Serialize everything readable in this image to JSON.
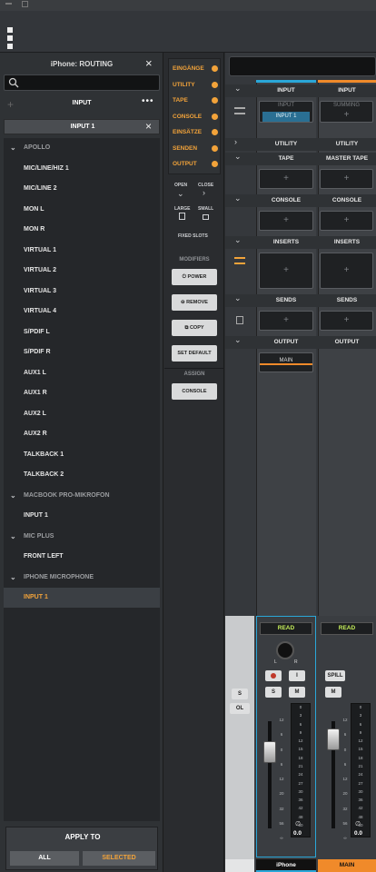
{
  "routing": {
    "title": "iPhone: ROUTING",
    "tab_label": "INPUT",
    "selected_input": "INPUT 1",
    "items": [
      {
        "label": "APOLLO",
        "type": "group"
      },
      {
        "label": "MIC/LINE/HIZ 1",
        "type": "item"
      },
      {
        "label": "MIC/LINE 2",
        "type": "item"
      },
      {
        "label": "MON L",
        "type": "item"
      },
      {
        "label": "MON R",
        "type": "item"
      },
      {
        "label": "VIRTUAL 1",
        "type": "item"
      },
      {
        "label": "VIRTUAL 2",
        "type": "item"
      },
      {
        "label": "VIRTUAL 3",
        "type": "item"
      },
      {
        "label": "VIRTUAL 4",
        "type": "item"
      },
      {
        "label": "S/PDIF L",
        "type": "item"
      },
      {
        "label": "S/PDIF R",
        "type": "item"
      },
      {
        "label": "AUX1 L",
        "type": "item"
      },
      {
        "label": "AUX1 R",
        "type": "item"
      },
      {
        "label": "AUX2 L",
        "type": "item"
      },
      {
        "label": "AUX2 R",
        "type": "item"
      },
      {
        "label": "TALKBACK 1",
        "type": "item"
      },
      {
        "label": "TALKBACK 2",
        "type": "item"
      },
      {
        "label": "MACBOOK PRO-MIKROFON",
        "type": "group"
      },
      {
        "label": "INPUT 1",
        "type": "item"
      },
      {
        "label": "MIC PLUS",
        "type": "group"
      },
      {
        "label": "FRONT LEFT",
        "type": "item"
      },
      {
        "label": "IPHONE MICROPHONE",
        "type": "group"
      },
      {
        "label": "INPUT 1",
        "type": "selected"
      }
    ],
    "apply": {
      "title": "APPLY TO",
      "all": "ALL",
      "selected": "SELECTED"
    }
  },
  "nav": {
    "items": [
      "EINGÄNGE",
      "UTILITY",
      "TAPE",
      "CONSOLE",
      "EINSÄTZE",
      "SENDEN",
      "OUTPUT"
    ],
    "open": "OPEN",
    "close": "CLOSE",
    "large": "LARGE",
    "small": "SMALL",
    "fixed_slots": "FIXED SLOTS"
  },
  "modifiers": {
    "title": "MODIFIERS",
    "power": "POWER",
    "remove": "REMOVE",
    "copy": "COPY",
    "set_default": "SET DEFAULT"
  },
  "assign": {
    "title": "ASSIGN",
    "console": "CONSOLE"
  },
  "strips": {
    "rows": {
      "input": "INPUT",
      "utility": "UTILITY",
      "tape": "TAPE",
      "master_tape": "MASTER TAPE",
      "console": "CONSOLE",
      "inserts": "INSERTS",
      "sends": "SENDS",
      "output": "OUTPUT"
    },
    "iphone_input_label": "INPUT",
    "iphone_input_value": "INPUT 1",
    "main_summing": "SUMMING",
    "output_main": "MAIN",
    "plus": "+"
  },
  "mixer": {
    "read": "READ",
    "lr_l": "L",
    "lr_r": "R",
    "btn_s": "S",
    "btn_ol": "OL",
    "btn_m": "M",
    "btn_i": "I",
    "btn_spill": "SPILL",
    "fader_scale": [
      "12",
      "6",
      "0",
      "6",
      "12",
      "20",
      "32",
      "56",
      "∞"
    ],
    "meter_scale": [
      "0",
      "3",
      "6",
      "9",
      "12",
      "15",
      "18",
      "21",
      "24",
      "27",
      "30",
      "36",
      "42",
      "48",
      "60"
    ],
    "gain_iphone": "0.0",
    "gain_main": "0.0",
    "phase": "∅",
    "strip_names": {
      "iphone": "iPhone",
      "main": "MAIN"
    }
  },
  "colors": {
    "accent": "#f2a33a",
    "iphone": "#2aa7d8",
    "main": "#f08a2a",
    "read": "#c7f05a"
  }
}
